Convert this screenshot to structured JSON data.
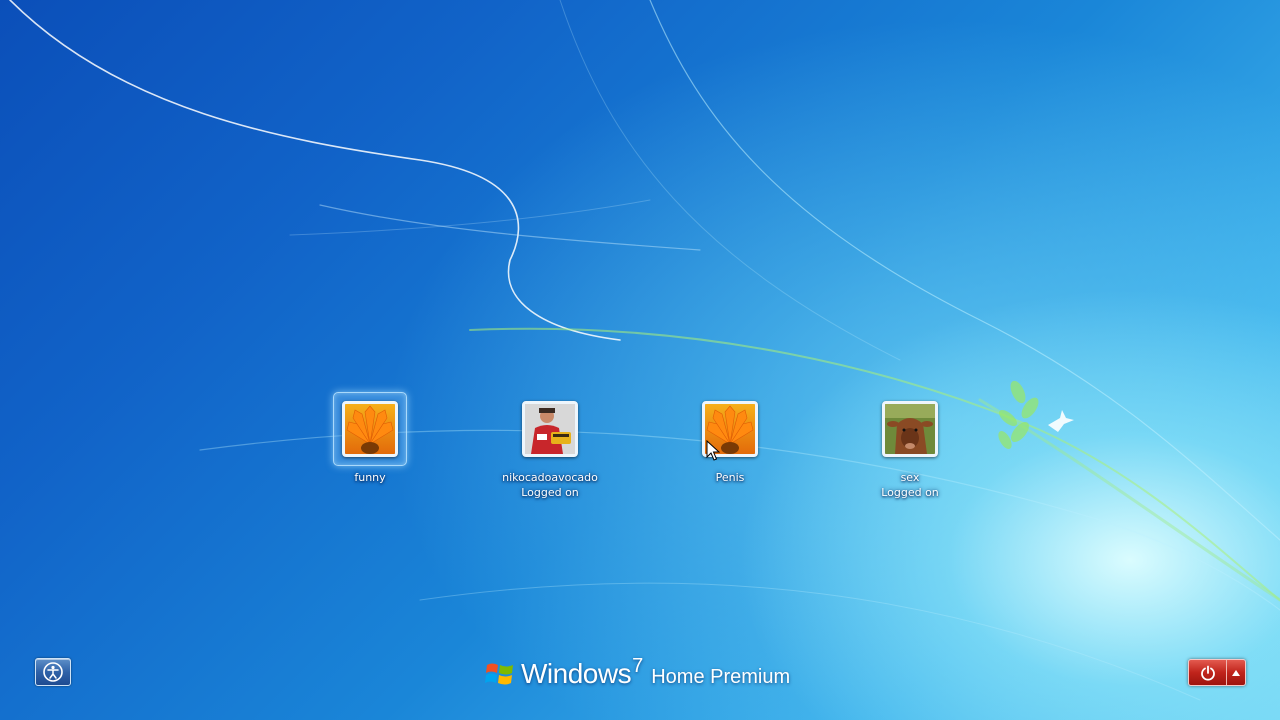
{
  "users": [
    {
      "name": "funny",
      "status": "",
      "avatar_icon": "flower-avatar-icon",
      "selected": true
    },
    {
      "name": "nikocadoavocado",
      "status": "Logged on",
      "avatar_icon": "person-avatar-icon",
      "selected": false
    },
    {
      "name": "Penis",
      "status": "",
      "avatar_icon": "flower-avatar-icon",
      "selected": false
    },
    {
      "name": "sex",
      "status": "Logged on",
      "avatar_icon": "cow-avatar-icon",
      "selected": false
    }
  ],
  "branding": {
    "word": "Windows",
    "version": "7",
    "edition": "Home Premium"
  },
  "buttons": {
    "ease_of_access_icon": "ease-of-access-icon",
    "shutdown_icon": "power-icon",
    "shutdown_options_icon": "triangle-up-icon"
  },
  "colors": {
    "shutdown_red": "#c0241b",
    "ease_blue": "#2f62a8"
  }
}
